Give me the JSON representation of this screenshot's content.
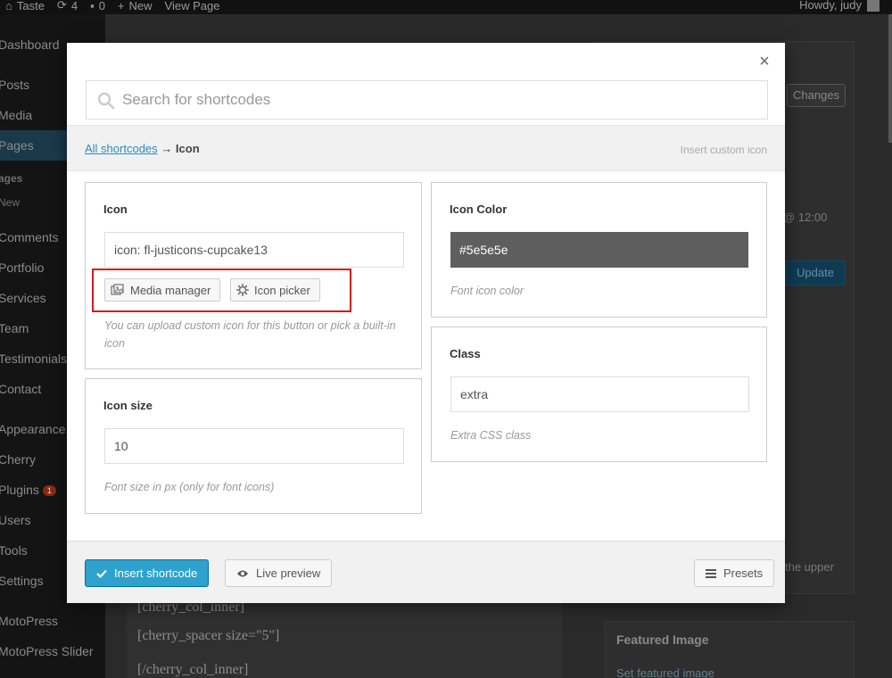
{
  "adminbar": {
    "site": "Taste",
    "updates": "4",
    "comments": "0",
    "new": "New",
    "view_page": "View Page",
    "howdy": "Howdy, judy"
  },
  "sidebar": {
    "items": [
      "Dashboard",
      "Posts",
      "Media",
      "Pages",
      "ages",
      "New",
      "Comments",
      "Portfolio",
      "Services",
      "Team",
      "Testimonials",
      "Contact",
      "Appearance",
      "Cherry",
      "Plugins",
      "Users",
      "Tools",
      "Settings",
      "MotoPress",
      "MotoPress Slider"
    ],
    "plugins_badge": "1"
  },
  "background": {
    "changes_button": "Changes",
    "time_text": "@ 12:00",
    "update_button": "Update",
    "upper_text": "the upper",
    "editor_lines": [
      "[cherry_col_inner]",
      "[cherry_spacer size=\"5\"]",
      "[/cherry_col_inner]"
    ],
    "featured_title": "Featured Image",
    "featured_link": "Set featured image"
  },
  "modal": {
    "search_placeholder": "Search for shortcodes",
    "breadcrumb": {
      "link": "All shortcodes",
      "arrow": "→",
      "current": "Icon",
      "description": "Insert custom icon"
    },
    "icon_panel": {
      "title": "Icon",
      "value": "icon: fl-justicons-cupcake13",
      "media_manager": "Media manager",
      "icon_picker": "Icon picker",
      "hint": "You can upload custom icon for this button or pick a built-in icon"
    },
    "icon_size_panel": {
      "title": "Icon size",
      "value": "10",
      "hint": "Font size in px (only for font icons)"
    },
    "icon_color_panel": {
      "title": "Icon Color",
      "value": "#5e5e5e",
      "hint": "Font icon color"
    },
    "class_panel": {
      "title": "Class",
      "value": "extra",
      "hint": "Extra CSS class"
    },
    "footer": {
      "insert": "Insert shortcode",
      "preview": "Live preview",
      "presets": "Presets"
    }
  },
  "colors": {
    "accent": "#2ea2cc",
    "swatch": "#5e5e5e",
    "highlight": "#d71818"
  }
}
